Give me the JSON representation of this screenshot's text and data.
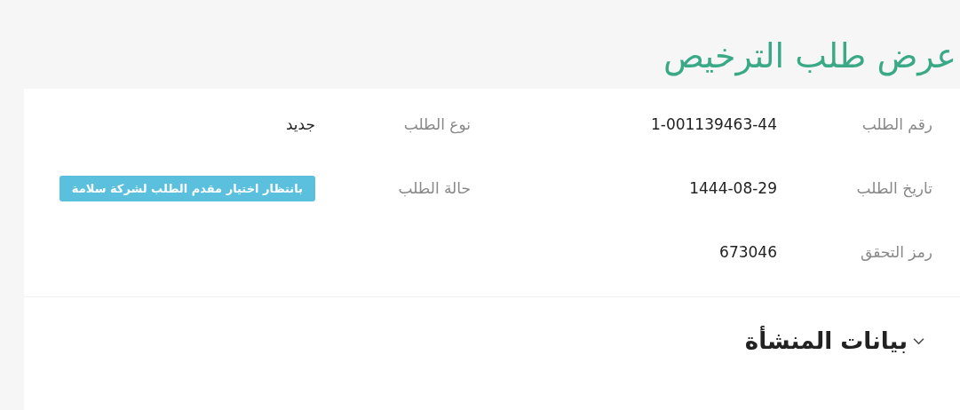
{
  "page_title": "عرض طلب الترخيص",
  "fields": [
    {
      "label": "رقم الطلب",
      "value": "1-001139463-44",
      "kind": "text"
    },
    {
      "label": "نوع الطلب",
      "value": "جديد",
      "kind": "text"
    },
    {
      "label": "تاريخ الطلب",
      "value": "1444-08-29",
      "kind": "text"
    },
    {
      "label": "حالة الطلب",
      "value": "بانتظار اختيار مقدم الطلب لشركة سلامة",
      "kind": "badge"
    },
    {
      "label": "رمز التحقق",
      "value": "673046",
      "kind": "text"
    }
  ],
  "section": {
    "title": "بيانات المنشأة",
    "expanded": true
  }
}
